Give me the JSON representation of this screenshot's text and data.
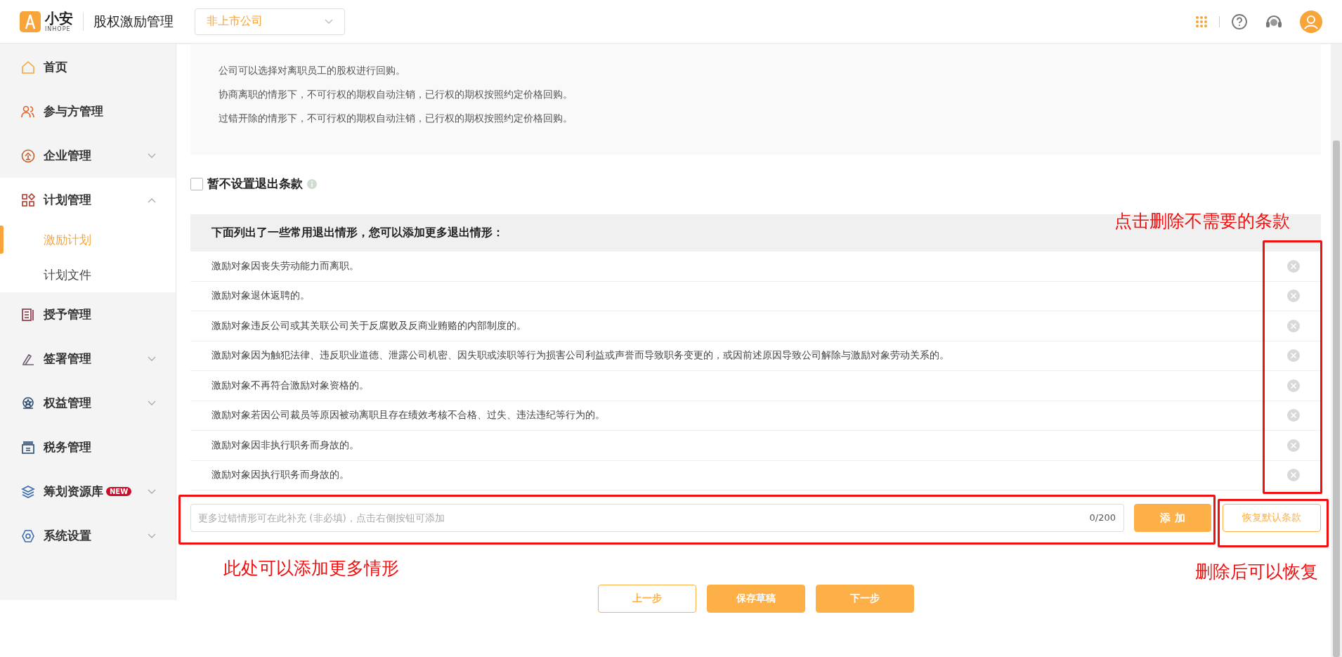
{
  "header": {
    "logo_text": "小安",
    "logo_sub": "INHOPE",
    "app_title": "股权激励管理",
    "company_select": "非上市公司"
  },
  "sidebar": {
    "items": [
      {
        "label": "首页",
        "selected": false
      },
      {
        "label": "参与方管理",
        "selected": false
      },
      {
        "label": "企业管理",
        "selected": false,
        "expanded": false
      },
      {
        "label": "计划管理",
        "selected": false,
        "expanded": true,
        "children": [
          {
            "label": "激励计划",
            "selected": true
          },
          {
            "label": "计划文件",
            "selected": false
          }
        ]
      },
      {
        "label": "授予管理",
        "selected": false
      },
      {
        "label": "签署管理",
        "selected": false,
        "expanded": false
      },
      {
        "label": "权益管理",
        "selected": false,
        "expanded": false
      },
      {
        "label": "税务管理",
        "selected": false
      },
      {
        "label": "筹划资源库",
        "selected": false,
        "expanded": false,
        "badge": "NEW"
      },
      {
        "label": "系统设置",
        "selected": false,
        "expanded": false
      }
    ]
  },
  "info_lines": [
    "公司可以选择对离职员工的股权进行回购。",
    "协商离职的情形下，不可行权的期权自动注销，已行权的期权按照约定价格回购。",
    "过错开除的情形下，不可行权的期权自动注销，已行权的期权按照约定价格回购。"
  ],
  "no_exit_clause": {
    "label": "暂不设置退出条款",
    "checked": false
  },
  "clauses": {
    "heading": "下面列出了一些常用退出情形，您可以添加更多退出情形：",
    "rows": [
      "激励对象因丧失劳动能力而离职。",
      "激励对象退休返聘的。",
      "激励对象违反公司或其关联公司关于反腐败及反商业贿赂的内部制度的。",
      "激励对象因为触犯法律、违反职业道德、泄露公司机密、因失职或渎职等行为损害公司利益或声誉而导致职务变更的，或因前述原因导致公司解除与激励对象劳动关系的。",
      "激励对象不再符合激励对象资格的。",
      "激励对象若因公司裁员等原因被动离职且存在绩效考核不合格、过失、违法违纪等行为的。",
      "激励对象因非执行职务而身故的。",
      "激励对象因执行职务而身故的。"
    ]
  },
  "add_clause": {
    "placeholder": "更多过错情形可在此补充 (非必填)，点击右侧按钮可添加",
    "counter": "0/200",
    "add_button": "添 加",
    "restore_button": "恢复默认条款"
  },
  "footer_buttons": [
    {
      "label": "上一步",
      "kind": "outline"
    },
    {
      "label": "保存草稿",
      "kind": "primary"
    },
    {
      "label": "下一步",
      "kind": "primary"
    }
  ],
  "annotations": [
    {
      "text": "点击删除不需要的条款",
      "kind": "delete"
    },
    {
      "text": "此处可以添加更多情形",
      "kind": "add"
    },
    {
      "text": "删除后可以恢复",
      "kind": "restore"
    }
  ]
}
